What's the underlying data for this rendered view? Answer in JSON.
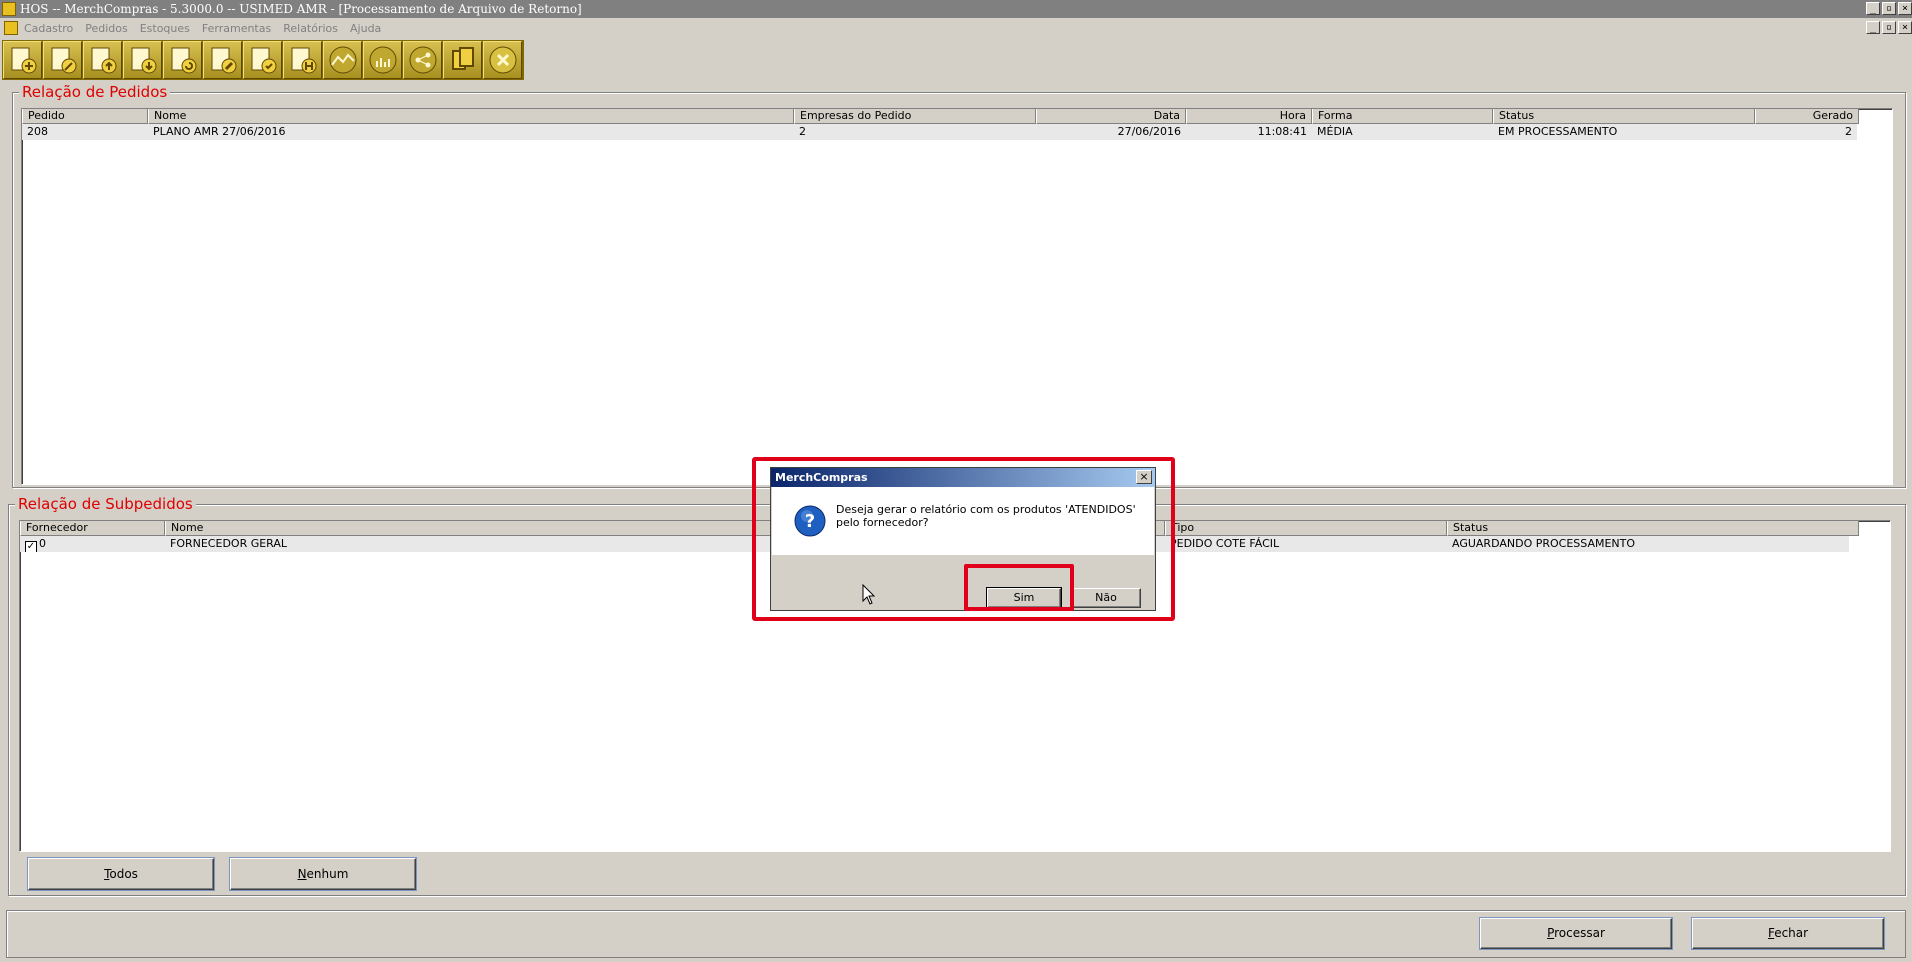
{
  "window": {
    "title": "HOS -- MerchCompras - 5.3000.0  --  USIMED AMR - [Processamento de Arquivo de Retorno]",
    "min": "_",
    "restore": "▫",
    "close": "×"
  },
  "menu": [
    "Cadastro",
    "Pedidos",
    "Estoques",
    "Ferramentas",
    "Relatórios",
    "Ajuda"
  ],
  "toolbar": [
    "add-document-icon",
    "edit-document-icon",
    "upload-document-icon",
    "download-document-icon",
    "refresh-document-icon",
    "tools-document-icon",
    "check-document-icon",
    "history-document-icon",
    "chart-line-icon",
    "bar-chart-icon",
    "share-icon",
    "copy-icon",
    "close-circle-icon"
  ],
  "pedidos": {
    "title": "Relação de Pedidos",
    "columns": [
      "Pedido",
      "Nome",
      "Empresas do Pedido",
      "Data",
      "Hora",
      "Forma",
      "Status",
      "Gerado"
    ],
    "rows": [
      [
        "208",
        "PLANO AMR 27/06/2016",
        "2",
        "27/06/2016",
        "11:08:41",
        "MÉDIA",
        "EM PROCESSAMENTO",
        "2"
      ]
    ]
  },
  "subpedidos": {
    "title": "Relação de Subpedidos",
    "columns": [
      "Fornecedor",
      "Nome",
      "Tipo",
      "Status"
    ],
    "rows": [
      [
        "0",
        "FORNECEDOR GERAL",
        "PEDIDO COTE FÁCIL",
        "AGUARDANDO PROCESSAMENTO"
      ]
    ],
    "checkmark": "✓"
  },
  "buttons": {
    "todos_u": "T",
    "todos_rest": "odos",
    "nenhum_u": "N",
    "nenhum_rest": "enhum",
    "processar_u": "P",
    "processar_rest": "rocessar",
    "fechar_u": "F",
    "fechar_rest": "echar"
  },
  "dialog": {
    "title": "MerchCompras",
    "close": "×",
    "message": "Deseja gerar o relatório com os produtos 'ATENDIDOS' pelo fornecedor?",
    "yes": "Sim",
    "no": "Não",
    "icon": "question-icon"
  },
  "colors": {
    "group_title": "#e00000",
    "highlight": "#e0001a",
    "toolbar": "#c0a830"
  }
}
